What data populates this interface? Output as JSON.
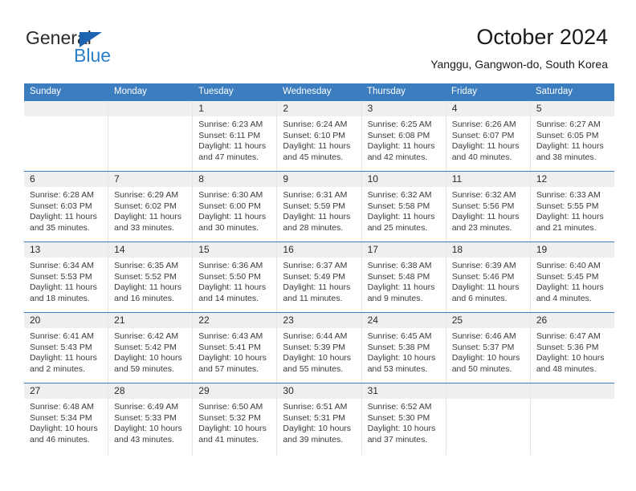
{
  "logo": {
    "word_top": "General",
    "word_bottom": "Blue",
    "triangle_color": "#1c64b0",
    "blue_color": "#2a7fc9",
    "dark_color": "#2b2b2b"
  },
  "header": {
    "title": "October 2024",
    "subtitle": "Yanggu, Gangwon-do, South Korea"
  },
  "theme": {
    "header_blue": "#3c7dc0",
    "day_band_gray": "#efefef",
    "cell_border": "#e6e6e6",
    "text": "#3a3a3a"
  },
  "weekdays": [
    "Sunday",
    "Monday",
    "Tuesday",
    "Wednesday",
    "Thursday",
    "Friday",
    "Saturday"
  ],
  "weeks": [
    [
      {
        "day": "",
        "sunrise": "",
        "sunset": "",
        "daylight_1": "",
        "daylight_2": ""
      },
      {
        "day": "",
        "sunrise": "",
        "sunset": "",
        "daylight_1": "",
        "daylight_2": ""
      },
      {
        "day": "1",
        "sunrise": "Sunrise: 6:23 AM",
        "sunset": "Sunset: 6:11 PM",
        "daylight_1": "Daylight: 11 hours",
        "daylight_2": "and 47 minutes."
      },
      {
        "day": "2",
        "sunrise": "Sunrise: 6:24 AM",
        "sunset": "Sunset: 6:10 PM",
        "daylight_1": "Daylight: 11 hours",
        "daylight_2": "and 45 minutes."
      },
      {
        "day": "3",
        "sunrise": "Sunrise: 6:25 AM",
        "sunset": "Sunset: 6:08 PM",
        "daylight_1": "Daylight: 11 hours",
        "daylight_2": "and 42 minutes."
      },
      {
        "day": "4",
        "sunrise": "Sunrise: 6:26 AM",
        "sunset": "Sunset: 6:07 PM",
        "daylight_1": "Daylight: 11 hours",
        "daylight_2": "and 40 minutes."
      },
      {
        "day": "5",
        "sunrise": "Sunrise: 6:27 AM",
        "sunset": "Sunset: 6:05 PM",
        "daylight_1": "Daylight: 11 hours",
        "daylight_2": "and 38 minutes."
      }
    ],
    [
      {
        "day": "6",
        "sunrise": "Sunrise: 6:28 AM",
        "sunset": "Sunset: 6:03 PM",
        "daylight_1": "Daylight: 11 hours",
        "daylight_2": "and 35 minutes."
      },
      {
        "day": "7",
        "sunrise": "Sunrise: 6:29 AM",
        "sunset": "Sunset: 6:02 PM",
        "daylight_1": "Daylight: 11 hours",
        "daylight_2": "and 33 minutes."
      },
      {
        "day": "8",
        "sunrise": "Sunrise: 6:30 AM",
        "sunset": "Sunset: 6:00 PM",
        "daylight_1": "Daylight: 11 hours",
        "daylight_2": "and 30 minutes."
      },
      {
        "day": "9",
        "sunrise": "Sunrise: 6:31 AM",
        "sunset": "Sunset: 5:59 PM",
        "daylight_1": "Daylight: 11 hours",
        "daylight_2": "and 28 minutes."
      },
      {
        "day": "10",
        "sunrise": "Sunrise: 6:32 AM",
        "sunset": "Sunset: 5:58 PM",
        "daylight_1": "Daylight: 11 hours",
        "daylight_2": "and 25 minutes."
      },
      {
        "day": "11",
        "sunrise": "Sunrise: 6:32 AM",
        "sunset": "Sunset: 5:56 PM",
        "daylight_1": "Daylight: 11 hours",
        "daylight_2": "and 23 minutes."
      },
      {
        "day": "12",
        "sunrise": "Sunrise: 6:33 AM",
        "sunset": "Sunset: 5:55 PM",
        "daylight_1": "Daylight: 11 hours",
        "daylight_2": "and 21 minutes."
      }
    ],
    [
      {
        "day": "13",
        "sunrise": "Sunrise: 6:34 AM",
        "sunset": "Sunset: 5:53 PM",
        "daylight_1": "Daylight: 11 hours",
        "daylight_2": "and 18 minutes."
      },
      {
        "day": "14",
        "sunrise": "Sunrise: 6:35 AM",
        "sunset": "Sunset: 5:52 PM",
        "daylight_1": "Daylight: 11 hours",
        "daylight_2": "and 16 minutes."
      },
      {
        "day": "15",
        "sunrise": "Sunrise: 6:36 AM",
        "sunset": "Sunset: 5:50 PM",
        "daylight_1": "Daylight: 11 hours",
        "daylight_2": "and 14 minutes."
      },
      {
        "day": "16",
        "sunrise": "Sunrise: 6:37 AM",
        "sunset": "Sunset: 5:49 PM",
        "daylight_1": "Daylight: 11 hours",
        "daylight_2": "and 11 minutes."
      },
      {
        "day": "17",
        "sunrise": "Sunrise: 6:38 AM",
        "sunset": "Sunset: 5:48 PM",
        "daylight_1": "Daylight: 11 hours",
        "daylight_2": "and 9 minutes."
      },
      {
        "day": "18",
        "sunrise": "Sunrise: 6:39 AM",
        "sunset": "Sunset: 5:46 PM",
        "daylight_1": "Daylight: 11 hours",
        "daylight_2": "and 6 minutes."
      },
      {
        "day": "19",
        "sunrise": "Sunrise: 6:40 AM",
        "sunset": "Sunset: 5:45 PM",
        "daylight_1": "Daylight: 11 hours",
        "daylight_2": "and 4 minutes."
      }
    ],
    [
      {
        "day": "20",
        "sunrise": "Sunrise: 6:41 AM",
        "sunset": "Sunset: 5:43 PM",
        "daylight_1": "Daylight: 11 hours",
        "daylight_2": "and 2 minutes."
      },
      {
        "day": "21",
        "sunrise": "Sunrise: 6:42 AM",
        "sunset": "Sunset: 5:42 PM",
        "daylight_1": "Daylight: 10 hours",
        "daylight_2": "and 59 minutes."
      },
      {
        "day": "22",
        "sunrise": "Sunrise: 6:43 AM",
        "sunset": "Sunset: 5:41 PM",
        "daylight_1": "Daylight: 10 hours",
        "daylight_2": "and 57 minutes."
      },
      {
        "day": "23",
        "sunrise": "Sunrise: 6:44 AM",
        "sunset": "Sunset: 5:39 PM",
        "daylight_1": "Daylight: 10 hours",
        "daylight_2": "and 55 minutes."
      },
      {
        "day": "24",
        "sunrise": "Sunrise: 6:45 AM",
        "sunset": "Sunset: 5:38 PM",
        "daylight_1": "Daylight: 10 hours",
        "daylight_2": "and 53 minutes."
      },
      {
        "day": "25",
        "sunrise": "Sunrise: 6:46 AM",
        "sunset": "Sunset: 5:37 PM",
        "daylight_1": "Daylight: 10 hours",
        "daylight_2": "and 50 minutes."
      },
      {
        "day": "26",
        "sunrise": "Sunrise: 6:47 AM",
        "sunset": "Sunset: 5:36 PM",
        "daylight_1": "Daylight: 10 hours",
        "daylight_2": "and 48 minutes."
      }
    ],
    [
      {
        "day": "27",
        "sunrise": "Sunrise: 6:48 AM",
        "sunset": "Sunset: 5:34 PM",
        "daylight_1": "Daylight: 10 hours",
        "daylight_2": "and 46 minutes."
      },
      {
        "day": "28",
        "sunrise": "Sunrise: 6:49 AM",
        "sunset": "Sunset: 5:33 PM",
        "daylight_1": "Daylight: 10 hours",
        "daylight_2": "and 43 minutes."
      },
      {
        "day": "29",
        "sunrise": "Sunrise: 6:50 AM",
        "sunset": "Sunset: 5:32 PM",
        "daylight_1": "Daylight: 10 hours",
        "daylight_2": "and 41 minutes."
      },
      {
        "day": "30",
        "sunrise": "Sunrise: 6:51 AM",
        "sunset": "Sunset: 5:31 PM",
        "daylight_1": "Daylight: 10 hours",
        "daylight_2": "and 39 minutes."
      },
      {
        "day": "31",
        "sunrise": "Sunrise: 6:52 AM",
        "sunset": "Sunset: 5:30 PM",
        "daylight_1": "Daylight: 10 hours",
        "daylight_2": "and 37 minutes."
      },
      {
        "day": "",
        "sunrise": "",
        "sunset": "",
        "daylight_1": "",
        "daylight_2": ""
      },
      {
        "day": "",
        "sunrise": "",
        "sunset": "",
        "daylight_1": "",
        "daylight_2": ""
      }
    ]
  ]
}
